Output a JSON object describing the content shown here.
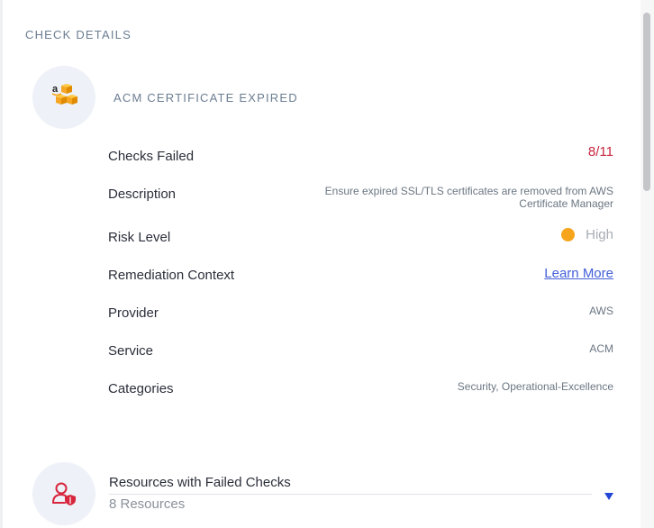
{
  "section_title": "CHECK DETAILS",
  "check": {
    "name": "ACM CERTIFICATE EXPIRED",
    "icon": "amazon-icon"
  },
  "details": {
    "checks_failed": {
      "label": "Checks Failed",
      "value": "8/11"
    },
    "description": {
      "label": "Description",
      "value": "Ensure expired SSL/TLS certificates are removed from AWS Certificate Manager"
    },
    "risk_level": {
      "label": "Risk Level",
      "value": "High",
      "color": "#f7a41d"
    },
    "remediation": {
      "label": "Remediation Context",
      "link_text": "Learn More"
    },
    "provider": {
      "label": "Provider",
      "value": "AWS"
    },
    "service": {
      "label": "Service",
      "value": "ACM"
    },
    "categories": {
      "label": "Categories",
      "value": "Security, Operational-Excellence"
    }
  },
  "resources": {
    "title": "Resources with Failed Checks",
    "count": "8 Resources",
    "icon": "user-shield-icon"
  },
  "colors": {
    "failed": "#c8263e",
    "link": "#4460d8",
    "accent": "#2346d6"
  }
}
